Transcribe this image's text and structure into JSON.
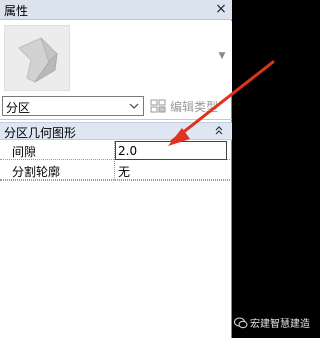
{
  "panel": {
    "title": "属性",
    "close_glyph": "×"
  },
  "preview": {
    "icon": "generic-model-icon",
    "dropdown_glyph": "▼"
  },
  "type_selector": {
    "value": "分区",
    "arrow": "⌵"
  },
  "edit_type": {
    "label": "编辑类型",
    "icon": "edit-type-icon"
  },
  "section": {
    "title": "分区几何图形",
    "collapse_glyph": "⌃"
  },
  "properties": [
    {
      "name": "间隙",
      "value": "2.0"
    },
    {
      "name": "分割轮廓",
      "value": "无"
    }
  ],
  "annotation": {
    "arrow_color": "#e0321f"
  },
  "watermark": {
    "text": "宏建智慧建造",
    "icon": "wechat-icon"
  }
}
